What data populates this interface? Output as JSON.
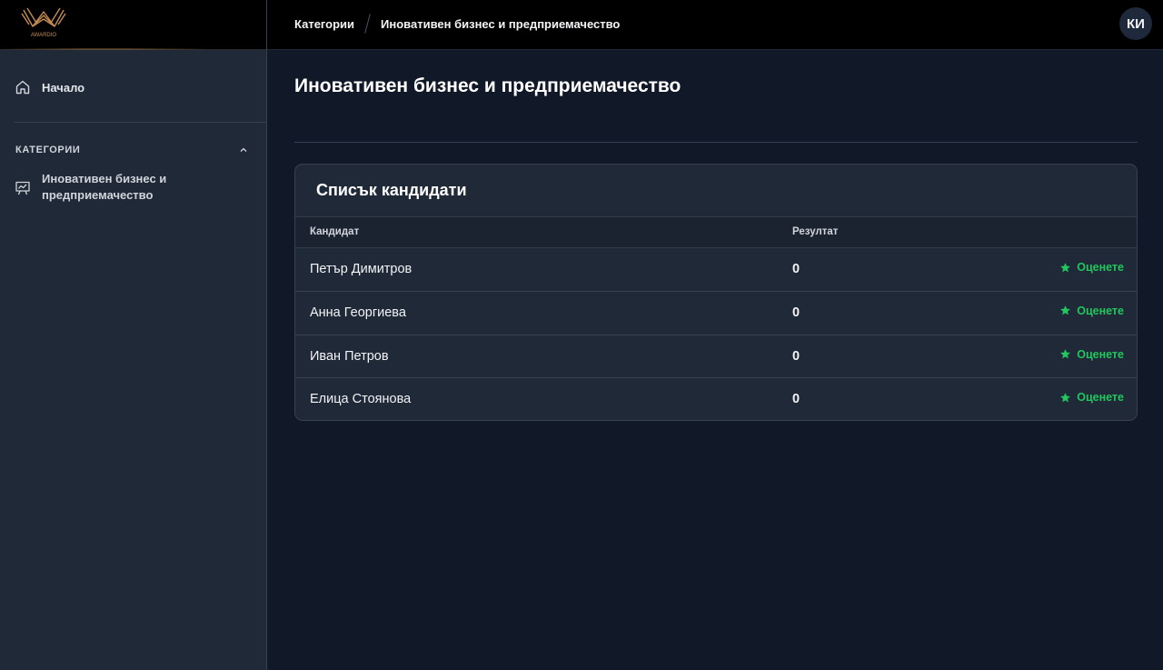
{
  "brand": {
    "logo_text": "AWARDIO",
    "accent": "#c48c54"
  },
  "sidebar": {
    "home_label": "Начало",
    "categories_heading": "КАТЕГОРИИ",
    "category_item": "Иновативен бизнес и предприемачество"
  },
  "topbar": {
    "breadcrumb_root": "Категории",
    "breadcrumb_current": "Иновативен бизнес и предприемачество",
    "avatar_initials": "КИ"
  },
  "main": {
    "page_title": "Иновативен бизнес и предприемачество",
    "card_title": "Списък кандидати",
    "columns": [
      "Кандидат",
      "Резултат"
    ],
    "rate_label": "Оценете",
    "rate_color": "#22c55e",
    "rows": [
      {
        "name": "Петър Димитров",
        "score": "0"
      },
      {
        "name": "Анна Георгиева",
        "score": "0"
      },
      {
        "name": "Иван Петров",
        "score": "0"
      },
      {
        "name": "Елица Стоянова",
        "score": "0"
      }
    ]
  }
}
